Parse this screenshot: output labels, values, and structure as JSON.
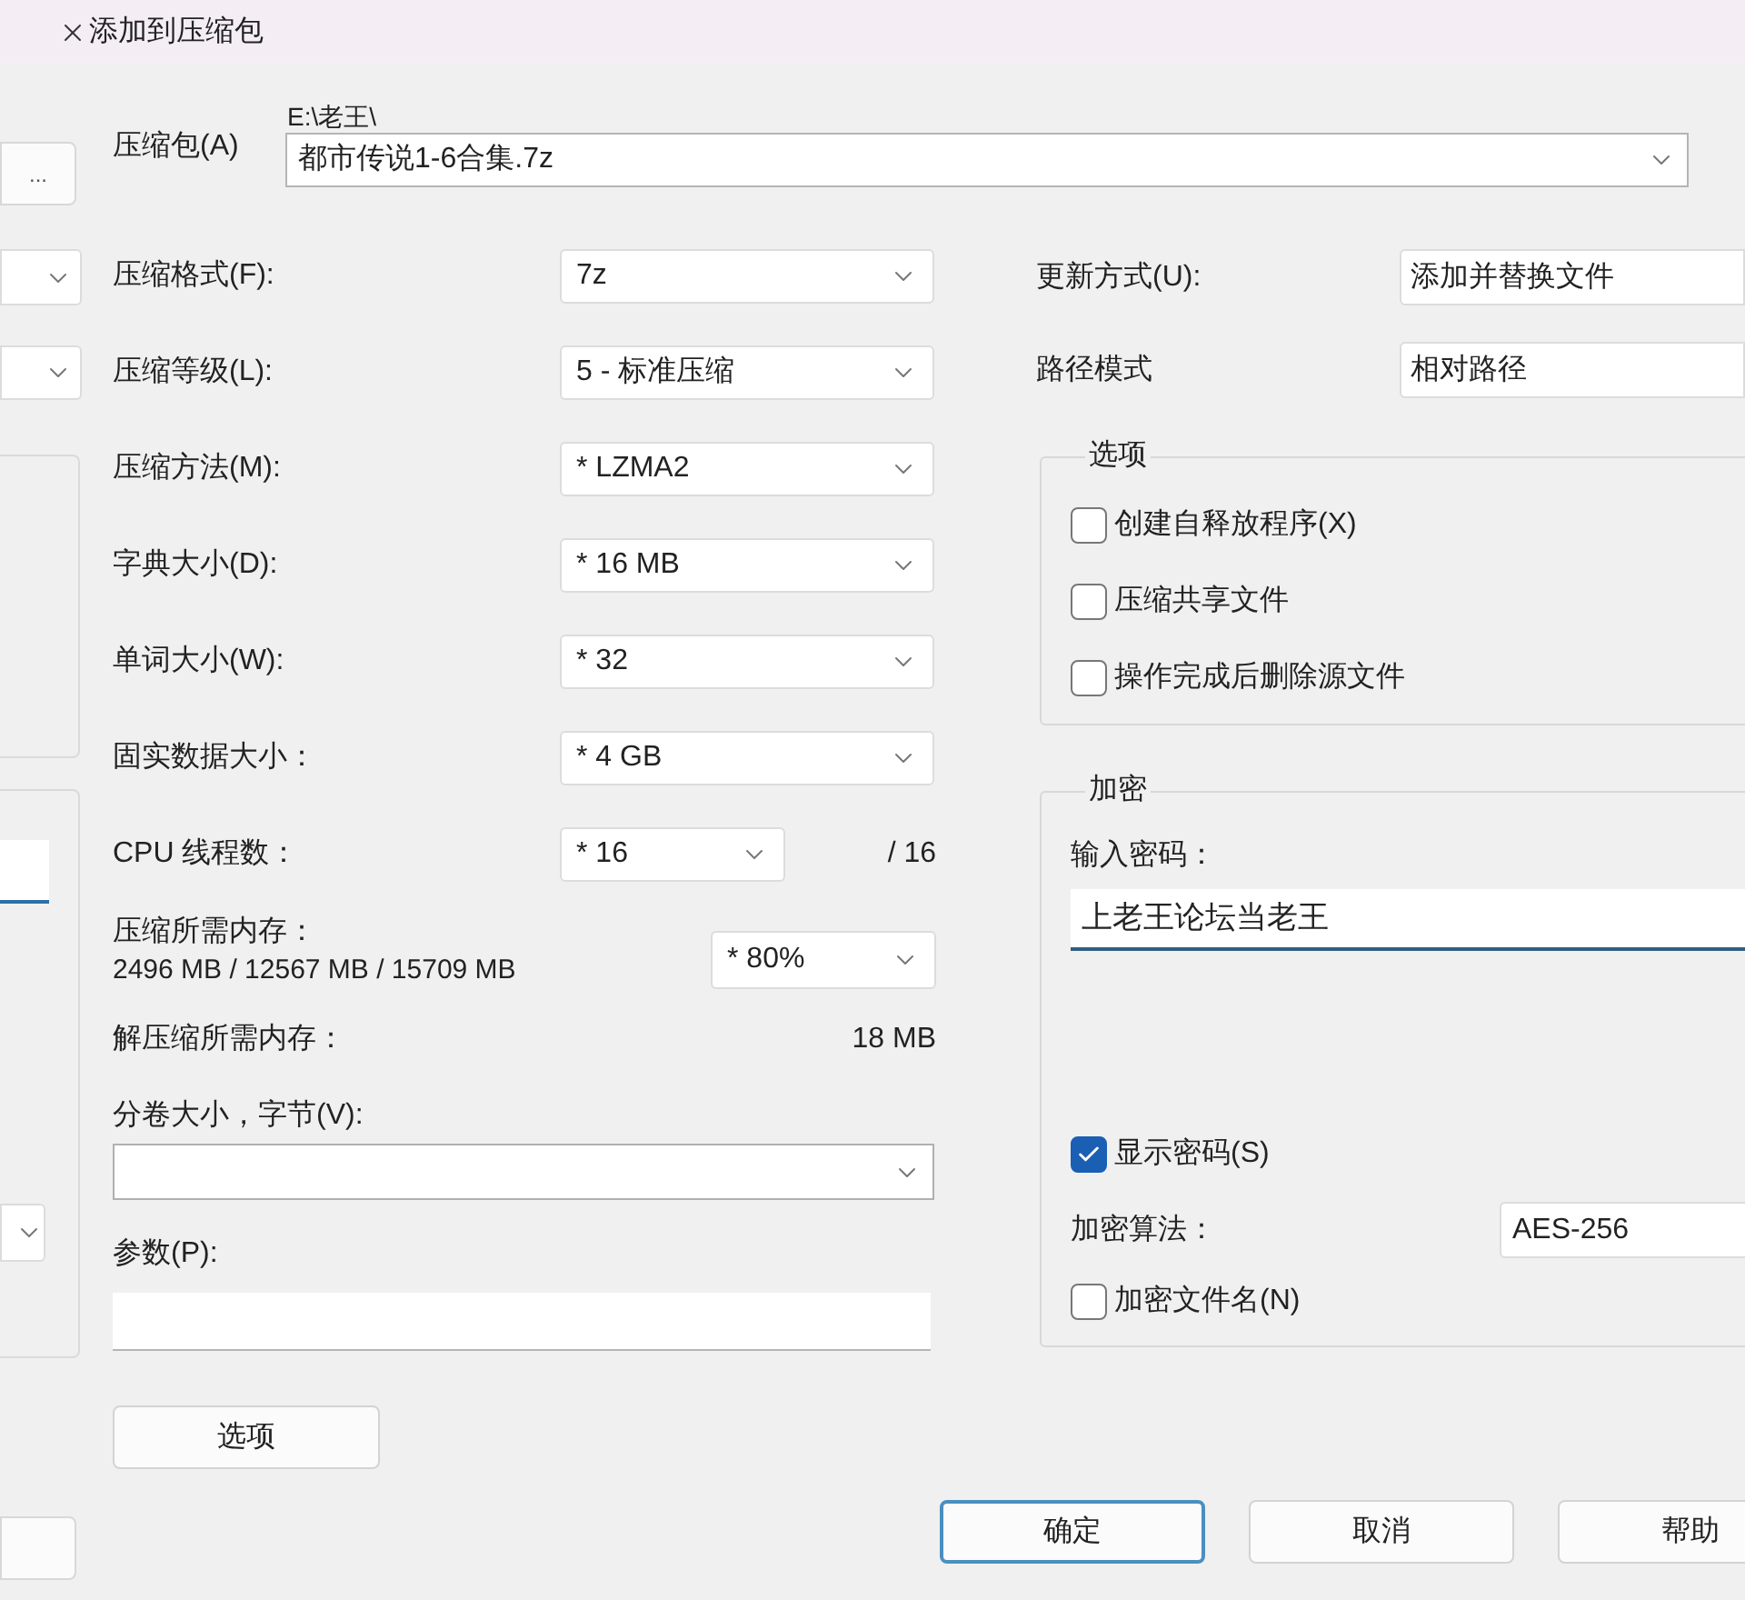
{
  "window": {
    "title": "添加到压缩包"
  },
  "browse_button": {
    "label": "..."
  },
  "archive": {
    "label": "压缩包(A)",
    "folder": "E:\\老王\\",
    "value": "都市传说1-6合集.7z"
  },
  "settings": [
    {
      "kind": "dropdown",
      "label": "压缩格式(F):",
      "value": "7z"
    },
    {
      "kind": "dropdown",
      "label": "压缩等级(L):",
      "value": "5 - 标准压缩"
    },
    {
      "kind": "dropdown",
      "label": "压缩方法(M):",
      "value": "* LZMA2"
    },
    {
      "kind": "dropdown",
      "label": "字典大小(D):",
      "value": "* 16 MB"
    },
    {
      "kind": "dropdown",
      "label": "单词大小(W):",
      "value": "* 32"
    },
    {
      "kind": "dropdown",
      "label": "固实数据大小：",
      "value": "* 4 GB"
    },
    {
      "kind": "threads",
      "label": "CPU 线程数：",
      "value": "* 16",
      "total": "/ 16"
    }
  ],
  "memory": {
    "label": "压缩所需内存：",
    "detail": "2496 MB / 12567 MB / 15709 MB",
    "value": "* 80%"
  },
  "decompress_memory": {
    "label": "解压缩所需内存：",
    "value": "18 MB"
  },
  "volume": {
    "label": "分卷大小，字节(V):"
  },
  "parameters": {
    "label": "参数(P):"
  },
  "options_button": {
    "label": "选项"
  },
  "update_mode": {
    "label": "更新方式(U):",
    "value": "添加并替换文件"
  },
  "path_mode": {
    "label": "路径模式",
    "value": "相对路径"
  },
  "options_group": {
    "title": "选项",
    "items": [
      {
        "label": "创建自释放程序(X)",
        "checked": false
      },
      {
        "label": "压缩共享文件",
        "checked": false
      },
      {
        "label": "操作完成后删除源文件",
        "checked": false
      }
    ]
  },
  "encryption": {
    "title": "加密",
    "password_label": "输入密码：",
    "password": "上老王论坛当老王",
    "show_password": {
      "label": "显示密码(S)",
      "checked": true
    },
    "method_label": "加密算法：",
    "method": "AES-256",
    "encrypt_names": {
      "label": "加密文件名(N)",
      "checked": false
    }
  },
  "buttons": [
    {
      "label": "确定",
      "default": true
    },
    {
      "label": "取消",
      "default": false
    },
    {
      "label": "帮助",
      "default": false
    }
  ]
}
